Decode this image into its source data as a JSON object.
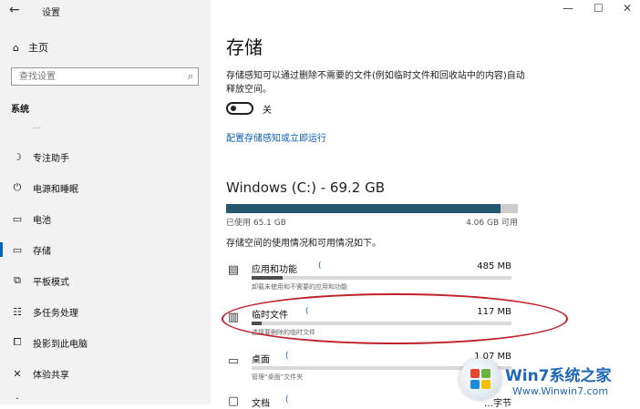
{
  "window": {
    "title": "设置",
    "back": "←",
    "minimize": "—",
    "maximize": "☐",
    "close": "✕"
  },
  "sidebar": {
    "home": "主页",
    "search_placeholder": "查找设置",
    "section": "系统",
    "cut_item": "…",
    "items": [
      {
        "label": "专注助手",
        "icon": "moon-icon"
      },
      {
        "label": "电源和睡眠",
        "icon": "power-icon"
      },
      {
        "label": "电池",
        "icon": "battery-icon"
      },
      {
        "label": "存储",
        "icon": "storage-icon",
        "active": true
      },
      {
        "label": "平板模式",
        "icon": "tablet-icon"
      },
      {
        "label": "多任务处理",
        "icon": "multitask-icon"
      },
      {
        "label": "投影到此电脑",
        "icon": "project-icon"
      },
      {
        "label": "体验共享",
        "icon": "share-icon"
      }
    ]
  },
  "main": {
    "title": "存储",
    "description": "存储感知可以通过删除不需要的文件(例如临时文件和回收站中的内容)自动释放空间。",
    "toggle_state": "关",
    "toggle_on": false,
    "config_link": "配置存储感知或立即运行",
    "drive": {
      "title": "Windows (C:) - 69.2 GB",
      "used": "已使用 65.1 GB",
      "free": "4.06 GB 可用",
      "used_fraction": 0.94
    },
    "usage_info": "存储空间的使用情况和可用情况如下。",
    "categories": [
      {
        "name": "应用和功能",
        "size": "485 MB",
        "sub": "卸载未使用和不需要的应用和功能",
        "fill": 0.12,
        "icon": "apps-icon"
      },
      {
        "name": "临时文件",
        "size": "117 MB",
        "sub": "选择要删除的临时文件",
        "fill": 0.04,
        "icon": "trash-icon"
      },
      {
        "name": "桌面",
        "size": "1.07 MB",
        "sub": "管理“桌面”文件夹",
        "fill": 0.0,
        "icon": "desktop-icon"
      },
      {
        "name": "文档",
        "size": "…字节",
        "sub": "",
        "fill": 0.0,
        "icon": "document-icon"
      }
    ]
  },
  "watermark": {
    "brand": "Win7系统之家",
    "url": "Www.Winwin7.com"
  },
  "colors": {
    "accent": "#0067c0",
    "drive_fill": "#23586f",
    "highlight": "#c0202a",
    "brand": "#1e67b8"
  }
}
